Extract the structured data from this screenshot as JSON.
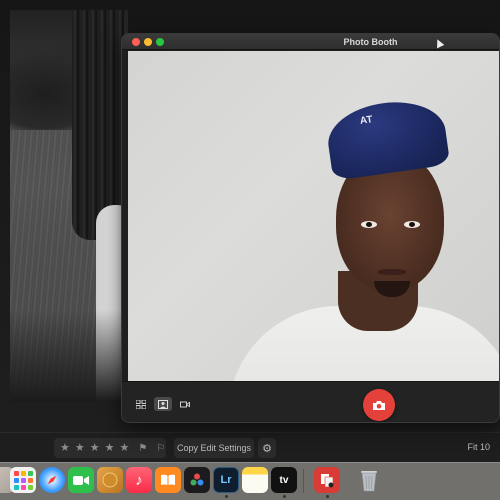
{
  "lightroom": {
    "rating_stars": [
      "★",
      "★",
      "★",
      "★",
      "★"
    ],
    "flags": [
      "⚑",
      "⚐"
    ],
    "copy_edit_settings": "Copy Edit Settings",
    "gear_glyph": "⚙",
    "fit_label": "Fit  10"
  },
  "photo_booth": {
    "title": "Photo Booth",
    "cap_logo": "AT",
    "traffic_colors": {
      "close": "#ff5f57",
      "minimize": "#febc2e",
      "maximize": "#28c840"
    },
    "shutter_color": "#e5413b"
  },
  "dock": {
    "apps": [
      {
        "name": "Launchpad",
        "icon": "launchpad-icon",
        "label": ""
      },
      {
        "name": "Safari",
        "icon": "safari-icon",
        "label": ""
      },
      {
        "name": "FaceTime",
        "icon": "facetime-icon",
        "label": ""
      },
      {
        "name": "Finder",
        "icon": "finder-icon",
        "label": ""
      },
      {
        "name": "Music",
        "icon": "music-icon",
        "label": "♪"
      },
      {
        "name": "Books",
        "icon": "books-icon",
        "label": ""
      },
      {
        "name": "DaVinci Resolve",
        "icon": "davinci-icon",
        "label": ""
      },
      {
        "name": "Lightroom",
        "icon": "lightroom-icon",
        "label": "Lr"
      },
      {
        "name": "Notes",
        "icon": "notes-icon",
        "label": ""
      },
      {
        "name": "Apple TV",
        "icon": "appletv-icon",
        "label": "tv"
      },
      {
        "name": "Photo Booth",
        "icon": "photobooth-icon",
        "label": ""
      },
      {
        "name": "Trash",
        "icon": "trash-icon",
        "label": ""
      }
    ]
  }
}
